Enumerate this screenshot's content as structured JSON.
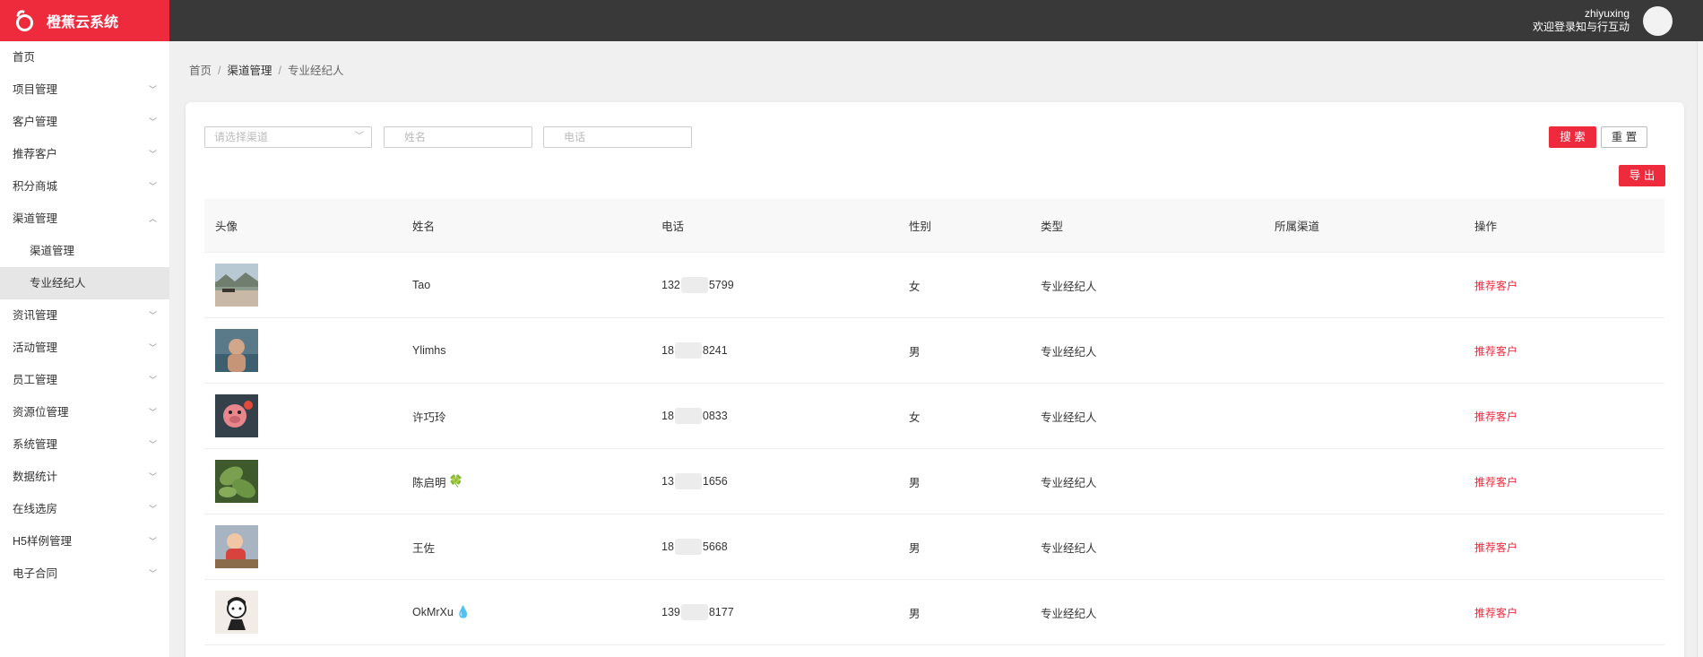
{
  "header": {
    "app_name": "橙蕉云系统",
    "username": "zhiyuxing",
    "welcome": "欢迎登录知与行互动"
  },
  "sidebar": {
    "items": [
      {
        "label": "首页",
        "has_chevron": false
      },
      {
        "label": "项目管理",
        "has_chevron": true
      },
      {
        "label": "客户管理",
        "has_chevron": true
      },
      {
        "label": "推荐客户",
        "has_chevron": true
      },
      {
        "label": "积分商城",
        "has_chevron": true
      },
      {
        "label": "渠道管理",
        "has_chevron": true,
        "expanded": true,
        "children": [
          {
            "label": "渠道管理",
            "active": false
          },
          {
            "label": "专业经纪人",
            "active": true
          }
        ]
      },
      {
        "label": "资讯管理",
        "has_chevron": true
      },
      {
        "label": "活动管理",
        "has_chevron": true
      },
      {
        "label": "员工管理",
        "has_chevron": true
      },
      {
        "label": "资源位管理",
        "has_chevron": true
      },
      {
        "label": "系统管理",
        "has_chevron": true
      },
      {
        "label": "数据统计",
        "has_chevron": true
      },
      {
        "label": "在线选房",
        "has_chevron": true
      },
      {
        "label": "H5样例管理",
        "has_chevron": true
      },
      {
        "label": "电子合同",
        "has_chevron": true
      }
    ]
  },
  "breadcrumb": [
    "首页",
    "渠道管理",
    "专业经纪人"
  ],
  "filters": {
    "channel_placeholder": "请选择渠道",
    "name_placeholder": "姓名",
    "phone_placeholder": "电话"
  },
  "buttons": {
    "search": "搜 索",
    "reset": "重 置",
    "export": "导 出"
  },
  "table": {
    "columns": [
      "头像",
      "姓名",
      "电话",
      "性别",
      "类型",
      "所属渠道",
      "操作"
    ],
    "rows": [
      {
        "name": "Tao",
        "emoji": "",
        "phone_prefix": "132",
        "phone_suffix": "5799",
        "gender": "女",
        "type": "专业经纪人",
        "channel": "",
        "action": "推荐客户",
        "avatar_icon": "landscape-photo-icon"
      },
      {
        "name": "Ylimhs",
        "emoji": "",
        "phone_prefix": "18",
        "phone_suffix": "8241",
        "gender": "男",
        "type": "专业经纪人",
        "channel": "",
        "action": "推荐客户",
        "avatar_icon": "person-photo-icon"
      },
      {
        "name": "许巧玲",
        "emoji": "",
        "phone_prefix": "18",
        "phone_suffix": "0833",
        "gender": "女",
        "type": "专业经纪人",
        "channel": "",
        "action": "推荐客户",
        "avatar_icon": "cartoon-pig-icon"
      },
      {
        "name": "陈启明",
        "emoji": "🍀",
        "phone_prefix": "13",
        "phone_suffix": "1656",
        "gender": "男",
        "type": "专业经纪人",
        "channel": "",
        "action": "推荐客户",
        "avatar_icon": "leaf-photo-icon"
      },
      {
        "name": "王佐",
        "emoji": "",
        "phone_prefix": "18",
        "phone_suffix": "5668",
        "gender": "男",
        "type": "专业经纪人",
        "channel": "",
        "action": "推荐客户",
        "avatar_icon": "child-photo-icon"
      },
      {
        "name": "OkMrXu",
        "emoji": "💧",
        "phone_prefix": "139",
        "phone_suffix": "8177",
        "gender": "男",
        "type": "专业经纪人",
        "channel": "",
        "action": "推荐客户",
        "avatar_icon": "cartoon-avatar-icon"
      }
    ]
  },
  "colors": {
    "accent": "#ee2b3d",
    "topbar": "#393939"
  }
}
